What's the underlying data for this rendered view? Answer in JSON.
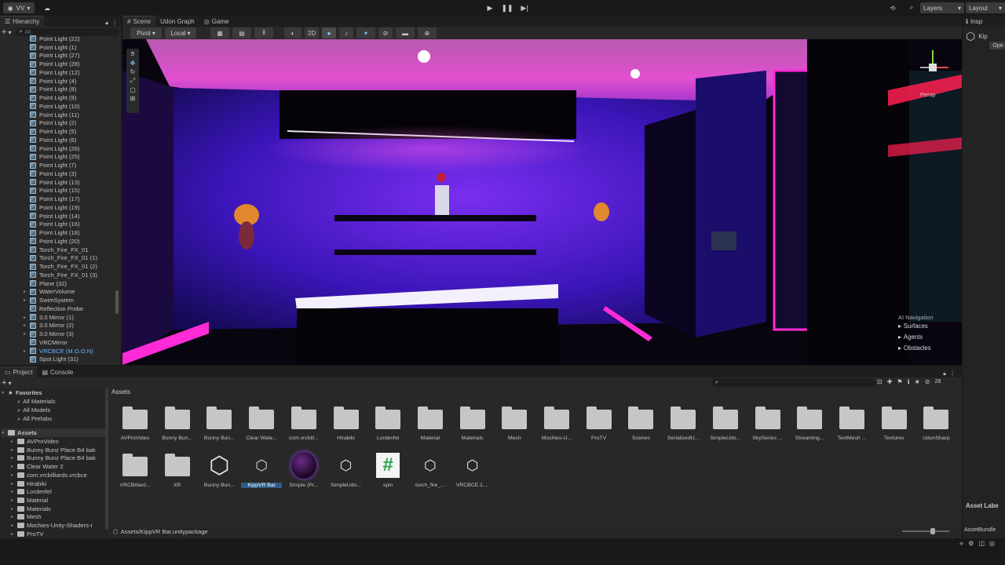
{
  "toolbar": {
    "account_label": "VV",
    "layers_label": "Layers",
    "layout_label": "Layout"
  },
  "hierarchy": {
    "tab": "Hierarchy",
    "search_placeholder": "All",
    "items": [
      "Point Light (22)",
      "Point Light (1)",
      "Point Light (27)",
      "Point Light (28)",
      "Point Light (12)",
      "Point Light (4)",
      "Point Light (8)",
      "Point Light (9)",
      "Point Light (10)",
      "Point Light (11)",
      "Point Light (2)",
      "Point Light (5)",
      "Point Light (6)",
      "Point Light (26)",
      "Point Light (25)",
      "Point Light (7)",
      "Point Light (3)",
      "Point Light (13)",
      "Point Light (15)",
      "Point Light (17)",
      "Point Light (19)",
      "Point Light (14)",
      "Point Light (16)",
      "Point Light (18)",
      "Point Light (20)",
      "Torch_Fire_FX_01",
      "Torch_Fire_FX_01 (1)",
      "Torch_Fire_FX_01 (2)",
      "Torch_Fire_FX_01 (3)",
      "Plane (32)",
      "WaterVolume",
      "SwimSystem",
      "Reflection Probe",
      "3.0 Mirror (1)",
      "3.0 Mirror (2)",
      "3.0 Mirror (3)",
      "VRCMirror",
      "VRCBCE (M.O.O.N)",
      "Spot Light (31)"
    ]
  },
  "scene": {
    "tabs": [
      "Scene",
      "Udon Graph",
      "Game"
    ],
    "pivot_label": "Pivot",
    "local_label": "Local",
    "mode_2d": "2D",
    "persp_label": "Persp",
    "ai_nav": {
      "title": "AI Navigation",
      "items": [
        "Surfaces",
        "Agents",
        "Obstacles"
      ]
    }
  },
  "project": {
    "tabs": [
      "Project",
      "Console"
    ],
    "favorites_title": "Favorites",
    "favorites": [
      "All Materials",
      "All Models",
      "All Prefabs"
    ],
    "assets_title": "Assets",
    "tree": [
      "AVProVideo",
      "Bunny Bunz Place B4 bak",
      "Bunny Bunz Place B4 bak",
      "Clear Water 2",
      "com.vrcbilliards.vrcbce",
      "Hirabiki",
      "Lordenfel",
      "Material",
      "Materials",
      "Mesh",
      "Mochies-Unity-Shaders-r",
      "ProTV"
    ],
    "breadcrumb": "Assets",
    "hidden_count": "28",
    "row1": [
      "AVProVideo",
      "Bunny Bun...",
      "Bunny Bun...",
      "Clear Wate...",
      "com.vrcbill...",
      "Hirabiki",
      "Lordenfel",
      "Material",
      "Materials",
      "Mesh",
      "Mochies-U...",
      "ProTV",
      "Scenes",
      "SerializedU...",
      "SimpleUdo...",
      "SkySeries ...",
      "Streaming...",
      "TextMesh ...",
      "Textures",
      "UdonSharp"
    ],
    "row2": [
      {
        "label": "VRCBillard...",
        "kind": "folder"
      },
      {
        "label": "XR",
        "kind": "folder"
      },
      {
        "label": "Bunny Bun...",
        "kind": "unity"
      },
      {
        "label": "KippVR Bar",
        "kind": "package",
        "selected": true
      },
      {
        "label": "Simple (Pr...",
        "kind": "material"
      },
      {
        "label": "SimpleUdo...",
        "kind": "unity-small"
      },
      {
        "label": "spin",
        "kind": "script"
      },
      {
        "label": "torch_fire_...",
        "kind": "unity-small"
      },
      {
        "label": "VRCBCE.1....",
        "kind": "unity-small"
      }
    ],
    "status_path": "Assets/KippVR Bar.unitypackage"
  },
  "inspector": {
    "tab": "Insp",
    "title": "Kip",
    "open_label": "Ope",
    "asset_labels": "Asset Labe",
    "asset_bundle": "AssetBundle"
  },
  "colors": {
    "bg": "#191919",
    "panel": "#282828",
    "selection": "#2c5d87",
    "accent_magenta": "#ff2bd6",
    "accent_purple": "#4a1bd0"
  }
}
